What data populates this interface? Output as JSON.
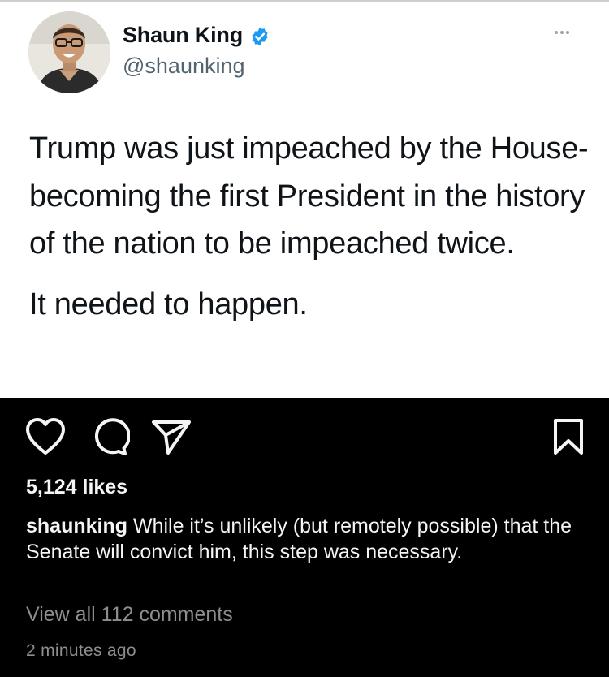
{
  "tweet": {
    "author": {
      "display_name": "Shaun King",
      "handle": "@shaunking",
      "verified": true
    },
    "paragraphs": [
      "Trump was just impeached by the House- becoming the first President in the history of the nation to be impeached twice.",
      "It needed to happen."
    ]
  },
  "post": {
    "likes": "5,124 likes",
    "caption_user": "shaunking",
    "caption_text": "While it’s unlikely (but remotely possible) that the Senate will convict him, this step was necessary.",
    "view_comments": "View all 112 comments",
    "timestamp": "2 minutes ago"
  },
  "icons": {
    "like": "heart-icon",
    "comment": "comment-bubble-icon",
    "share": "paper-plane-icon",
    "save": "bookmark-icon",
    "more": "ellipsis-icon",
    "verified": "verified-badge-icon"
  },
  "colors": {
    "tweet_background": "#ffffff",
    "tweet_text": "#0f1419",
    "handle_text": "#536471",
    "verified_blue": "#1d9bf0",
    "panel_background": "#000000",
    "panel_text": "#f5f5f5",
    "muted_text": "#8e8e8e"
  }
}
